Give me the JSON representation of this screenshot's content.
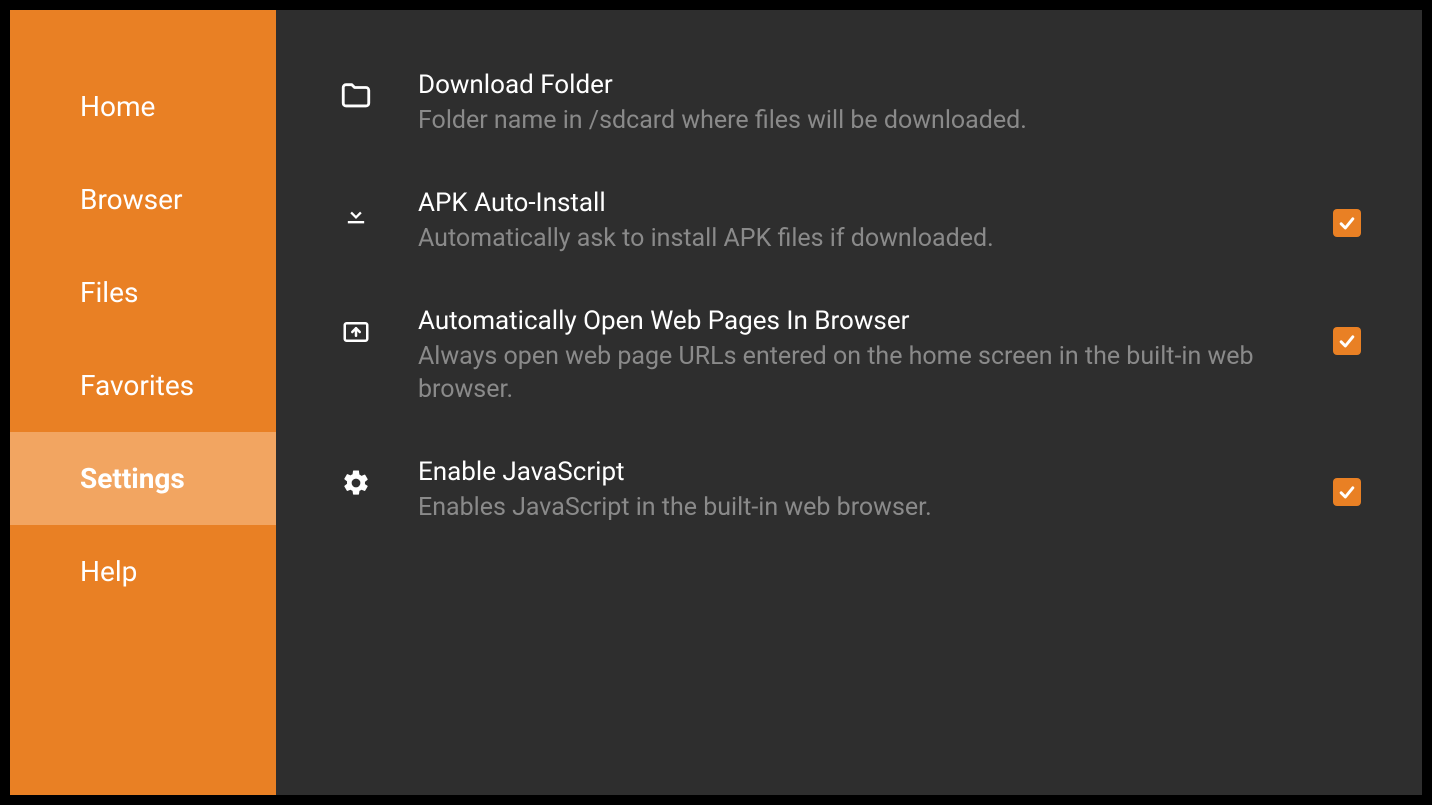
{
  "sidebar": {
    "items": [
      {
        "label": "Home",
        "active": false
      },
      {
        "label": "Browser",
        "active": false
      },
      {
        "label": "Files",
        "active": false
      },
      {
        "label": "Favorites",
        "active": false
      },
      {
        "label": "Settings",
        "active": true
      },
      {
        "label": "Help",
        "active": false
      }
    ]
  },
  "settings": [
    {
      "icon": "folder-icon",
      "title": "Download Folder",
      "description": "Folder name in /sdcard where files will be downloaded.",
      "has_checkbox": false,
      "checked": false
    },
    {
      "icon": "download-icon",
      "title": "APK Auto-Install",
      "description": "Automatically ask to install APK files if downloaded.",
      "has_checkbox": true,
      "checked": true
    },
    {
      "icon": "open-browser-icon",
      "title": "Automatically Open Web Pages In Browser",
      "description": "Always open web page URLs entered on the home screen in the built-in web browser.",
      "has_checkbox": true,
      "checked": true
    },
    {
      "icon": "gear-icon",
      "title": "Enable JavaScript",
      "description": "Enables JavaScript in the built-in web browser.",
      "has_checkbox": true,
      "checked": true
    }
  ],
  "colors": {
    "accent": "#e98024",
    "accent_light": "#f2a561",
    "panel_bg": "#2e2e2e",
    "text_primary": "#ffffff",
    "text_secondary": "#8a8a8a"
  }
}
